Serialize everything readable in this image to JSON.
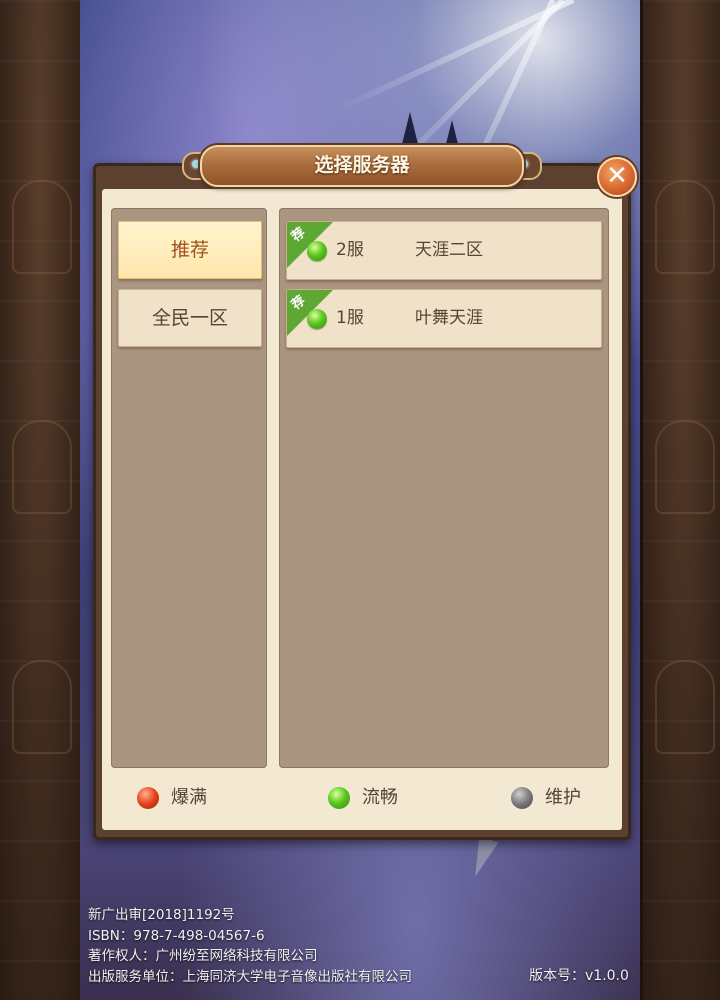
{
  "dialog": {
    "title": "选择服务器",
    "close_icon": "close-icon"
  },
  "zones": [
    {
      "label": "推荐",
      "active": true
    },
    {
      "label": "全民一区",
      "active": false
    }
  ],
  "servers": [
    {
      "tag": "荐",
      "status": "green",
      "number": "2服",
      "name": "天涯二区"
    },
    {
      "tag": "荐",
      "status": "green",
      "number": "1服",
      "name": "叶舞天涯"
    }
  ],
  "legend": [
    {
      "color": "#e4431c",
      "label": "爆满"
    },
    {
      "color": "#5bc81f",
      "label": "流畅"
    },
    {
      "color": "#7a7a7a",
      "label": "维护"
    }
  ],
  "footer": {
    "approval": "新广出审[2018]1192号",
    "isbn": "ISBN：978-7-498-04567-6",
    "copyright": "著作权人：广州纷至网络科技有限公司",
    "publisher": "出版服务单位：上海同济大学电子音像出版社有限公司",
    "version": "版本号：v1.0.0"
  }
}
